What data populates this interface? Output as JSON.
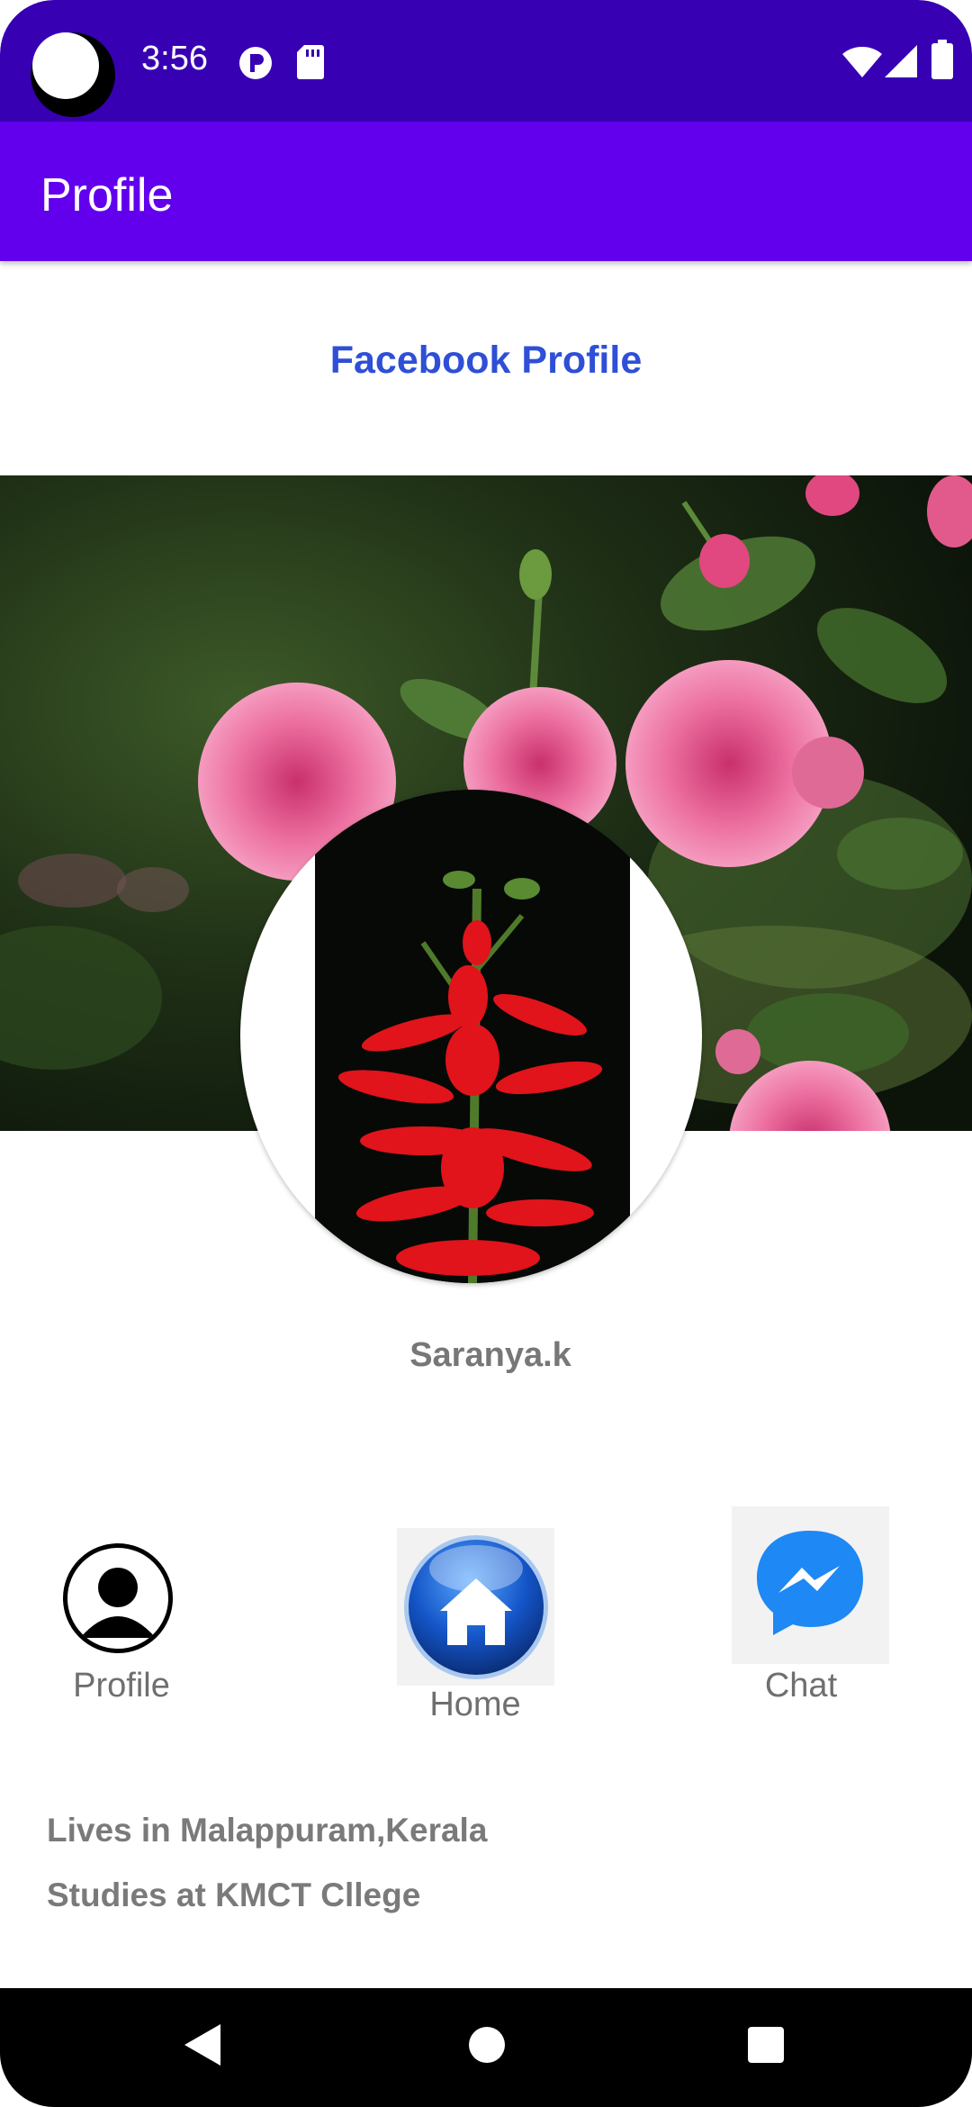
{
  "status_bar": {
    "time": "3:56",
    "icons": [
      "notification-p-icon",
      "sd-card-icon",
      "wifi-icon",
      "signal-icon",
      "battery-icon"
    ]
  },
  "app_bar": {
    "title": "Profile"
  },
  "header": {
    "title": "Facebook Profile"
  },
  "profile": {
    "name": "Saranya.k"
  },
  "actions": [
    {
      "label": "Profile",
      "icon": "person-icon"
    },
    {
      "label": "Home",
      "icon": "home-icon"
    },
    {
      "label": "Chat",
      "icon": "messenger-icon"
    }
  ],
  "about": {
    "lives": "Lives in Malappuram,Kerala",
    "studies": "Studies at KMCT Cllege"
  },
  "colors": {
    "status_bar": "#3700b3",
    "app_bar": "#6200ee",
    "header_text": "#2e4fd6"
  }
}
